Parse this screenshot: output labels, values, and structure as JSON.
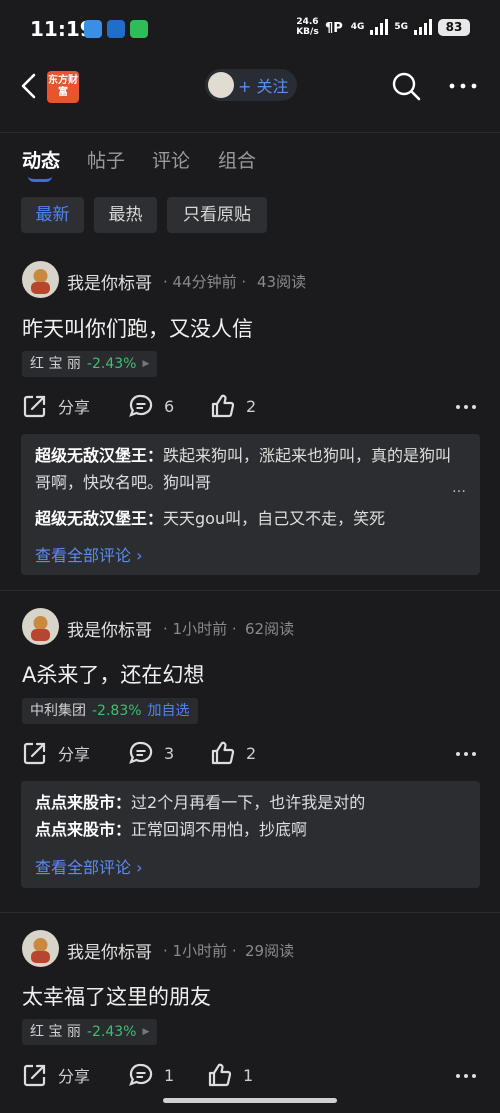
{
  "status": {
    "time": "11:19",
    "net_speed_value": "24.6",
    "net_speed_unit": "KB/s",
    "signal1_label": "4G",
    "signal2_label": "5G",
    "battery": "83"
  },
  "nav": {
    "brand": "东方财富",
    "follow_label": "+ 关注"
  },
  "tabs": [
    "动态",
    "帖子",
    "评论",
    "组合"
  ],
  "filters": [
    "最新",
    "最热",
    "只看原贴"
  ],
  "posts": [
    {
      "author": "我是你标哥",
      "time": "· 44分钟前 ·",
      "reads": "43阅读",
      "title": "昨天叫你们跑，又没人信",
      "stock": "红 宝 丽",
      "change": "-2.43%",
      "share": "分享",
      "comments_count": "6",
      "likes_count": "2",
      "comments": [
        {
          "user": "超级无敌汉堡王：",
          "text": "跌起来狗叫，涨起来也狗叫，真的是狗叫哥啊，快改名吧。狗叫哥"
        },
        {
          "user": "超级无敌汉堡王：",
          "text": "天天gou叫，自己又不走，笑死"
        }
      ],
      "see_all": "查看全部评论 ›"
    },
    {
      "author": "我是你标哥",
      "time": "· 1小时前 ·",
      "reads": "62阅读",
      "title": "A杀来了，还在幻想",
      "stock": "中利集团",
      "change": "-2.83%",
      "add_watch": "加自选",
      "share": "分享",
      "comments_count": "3",
      "likes_count": "2",
      "comments": [
        {
          "user": "点点来股市：",
          "text": "过2个月再看一下，也许我是对的"
        },
        {
          "user": "点点来股市：",
          "text": "正常回调不用怕，抄底啊"
        }
      ],
      "see_all": "查看全部评论 ›"
    },
    {
      "author": "我是你标哥",
      "time": "· 1小时前 ·",
      "reads": "29阅读",
      "title": "太幸福了这里的朋友",
      "stock": "红 宝 丽",
      "change": "-2.43%",
      "share": "分享",
      "comments_count": "1",
      "likes_count": "1"
    }
  ],
  "colors": {
    "accent": "#4d86f2",
    "down": "#3fbf6f",
    "background": "#1b1b1d",
    "brand": "#e8542c"
  },
  "icons": [
    "back-icon",
    "search-icon",
    "more-icon",
    "share-icon",
    "comment-icon",
    "like-icon"
  ]
}
